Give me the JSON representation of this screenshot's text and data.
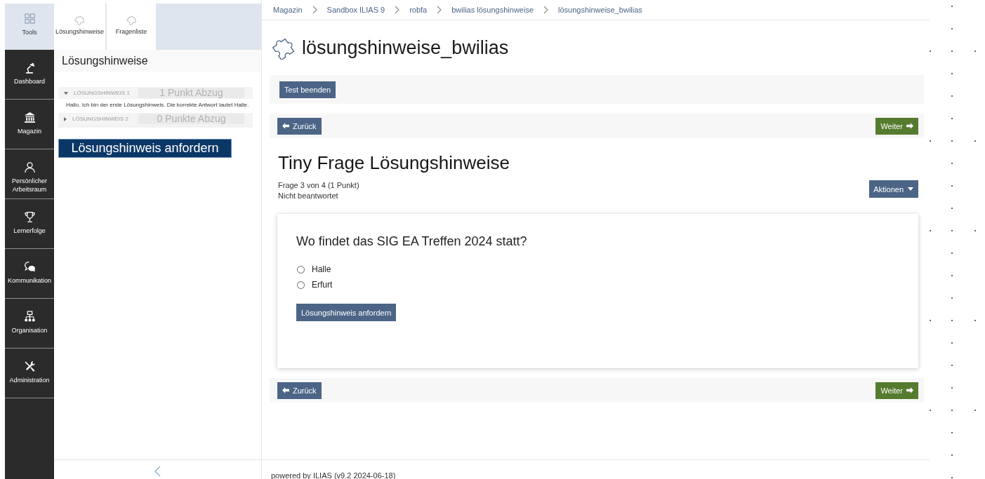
{
  "mainbar": {
    "tools": {
      "label": "Tools",
      "selected": true
    },
    "items": [
      {
        "label": "Dashboard",
        "selected": false
      },
      {
        "label": "Magazin",
        "selected": false
      },
      {
        "label": "Persönlicher Arbeitsraum",
        "selected": false
      },
      {
        "label": "Lernerfolge",
        "selected": false
      },
      {
        "label": "Kommunikation",
        "selected": false
      },
      {
        "label": "Organisation",
        "selected": false
      },
      {
        "label": "Administration",
        "selected": false
      }
    ]
  },
  "tool_tabs": [
    {
      "label": "Lösungshinweise"
    },
    {
      "label": "Fragenliste"
    }
  ],
  "slate": {
    "title": "Lösungshinweise",
    "hints": [
      {
        "label": "LÖSUNGSHINWEIS 1",
        "points": "1 Punkt Abzug",
        "expanded": true,
        "text": "Hallo. Ich bin der erste Lösungshinweis. Die korrekte Antwort lautet Halle."
      },
      {
        "label": "LÖSUNGSHINWEIS 2",
        "points": "0 Punkte Abzug",
        "expanded": false
      }
    ],
    "request_button": "Lösungshinweis anfordern"
  },
  "breadcrumbs": [
    "Magazin",
    "Sandbox ILIAS 9",
    "robfa",
    "bwilias lösungshinweise",
    "lösungshinweise_bwilias"
  ],
  "page_title": "lösungshinweise_bwilias",
  "toolbar": {
    "button": "Test beenden"
  },
  "navigation_top": {
    "previous": "Zurück",
    "next": "Weiter"
  },
  "question": {
    "title": "Tiny Frage Lösungshinweise",
    "meta": [
      "Frage 3 von 4 (1 Punkt)",
      "Nicht beantwortet"
    ],
    "actions_button": "Aktionen",
    "text": "Wo findet das SIG EA Treffen 2024 statt?",
    "options": [
      {
        "label": "Halle",
        "selected": false
      },
      {
        "label": "Erfurt",
        "selected": false
      }
    ],
    "hint_button": "Lösungshinweis anfordern"
  },
  "navigation_bottom": {
    "previous": "Zurück",
    "next": "Weiter"
  },
  "footer": "powered by ILIAS (v9.2 2024-06-18)"
}
